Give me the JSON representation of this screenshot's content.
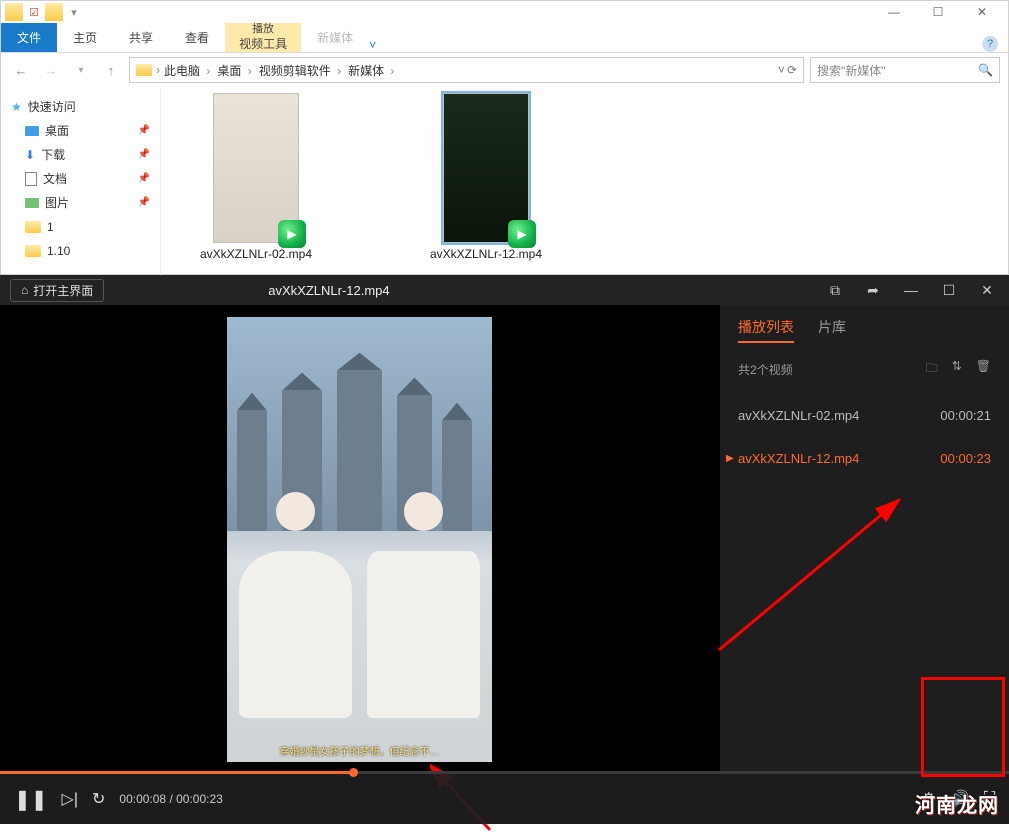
{
  "explorer": {
    "ribbon": {
      "file": "文件",
      "tabs": [
        "主页",
        "共享",
        "查看"
      ],
      "context_group": {
        "header": "播放",
        "tab": "视频工具"
      },
      "other_tab": "新媒体"
    },
    "window_buttons": {
      "min": "—",
      "max": "☐",
      "close": "✕"
    },
    "breadcrumb": [
      "此电脑",
      "桌面",
      "视频剪辑软件",
      "新媒体"
    ],
    "search_placeholder": "搜索\"新媒体\"",
    "nav": {
      "quick_access": "快速访问",
      "items": [
        {
          "label": "桌面"
        },
        {
          "label": "下载"
        },
        {
          "label": "文档"
        },
        {
          "label": "图片"
        },
        {
          "label": "1"
        },
        {
          "label": "1.10"
        }
      ]
    },
    "files": [
      {
        "name": "avXkXZLNLr-02.mp4"
      },
      {
        "name": "avXkXZLNLr-12.mp4"
      }
    ]
  },
  "player": {
    "home_button": "打开主界面",
    "title": "avXkXZLNLr-12.mp4",
    "subtitle_text": "穿婚纱是女孩子的梦想，但纪念不…",
    "time_current": "00:00:08",
    "time_total": "00:00:23",
    "playlist": {
      "tabs": {
        "list": "播放列表",
        "library": "片库"
      },
      "count_text": "共2个视频",
      "items": [
        {
          "name": "avXkXZLNLr-02.mp4",
          "duration": "00:00:21",
          "active": false
        },
        {
          "name": "avXkXZLNLr-12.mp4",
          "duration": "00:00:23",
          "active": true
        }
      ]
    }
  },
  "watermark": "河南龙网"
}
